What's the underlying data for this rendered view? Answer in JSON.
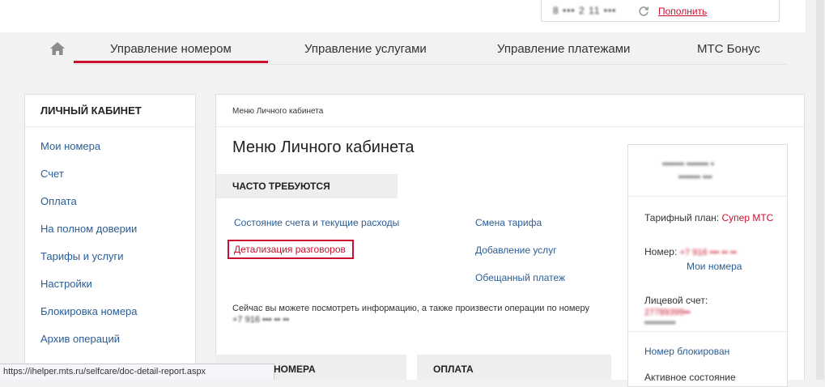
{
  "top_bar": {
    "balance_value": "8 ••• 2 11 •••",
    "topup_label": "Пополнить"
  },
  "nav": {
    "items": [
      {
        "label": "Управление номером"
      },
      {
        "label": "Управление услугами"
      },
      {
        "label": "Управление платежами"
      },
      {
        "label": "МТС Бонус"
      }
    ]
  },
  "sidebar": {
    "title": "ЛИЧНЫЙ КАБИНЕТ",
    "items": [
      {
        "label": "Мои номера"
      },
      {
        "label": "Счет"
      },
      {
        "label": "Оплата"
      },
      {
        "label": "На полном доверии"
      },
      {
        "label": "Тарифы и услуги"
      },
      {
        "label": "Настройки"
      },
      {
        "label": "Блокировка номера"
      },
      {
        "label": "Архив операций"
      }
    ]
  },
  "main": {
    "breadcrumb": "Меню Личного кабинета",
    "title": "Меню Личного кабинета",
    "section_title": "ЧАСТО ТРЕБУЮТСЯ",
    "left_links": [
      {
        "label": "Состояние счета и текущие расходы"
      },
      {
        "label": "Детализация разговоров"
      }
    ],
    "right_links": [
      {
        "label": "Смена тарифа"
      },
      {
        "label": "Добавление услуг"
      },
      {
        "label": "Обещанный платеж"
      }
    ],
    "info_text": "Сейчас вы можете посмотреть информацию, а также произвести операции по номеру",
    "info_number": "+7 916 ••• •• ••"
  },
  "card": {
    "name_line1": "••••••• ••••••• •",
    "name_line2": "••••••• •••",
    "tariff_label": "Тарифный план:",
    "tariff_value": "Супер МТС",
    "number_label": "Номер:",
    "number_value": "+7 916 ••• •• ••",
    "my_numbers_link": "Мои номера",
    "account_label": "Лицевой счет:",
    "account_value": "27789399••",
    "account_value2": "••••••••••",
    "blocked_link": "Номер блокирован",
    "active_state": "Активное состояние"
  },
  "bottom_panels": {
    "left_title": "НОМЕРА",
    "right_title": "ОПЛАТА"
  },
  "status_bar": {
    "url": "https://ihelper.mts.ru/selfcare/doc-detail-report.aspx"
  },
  "colors": {
    "accent": "#c8102e",
    "link": "#2a5d95"
  }
}
